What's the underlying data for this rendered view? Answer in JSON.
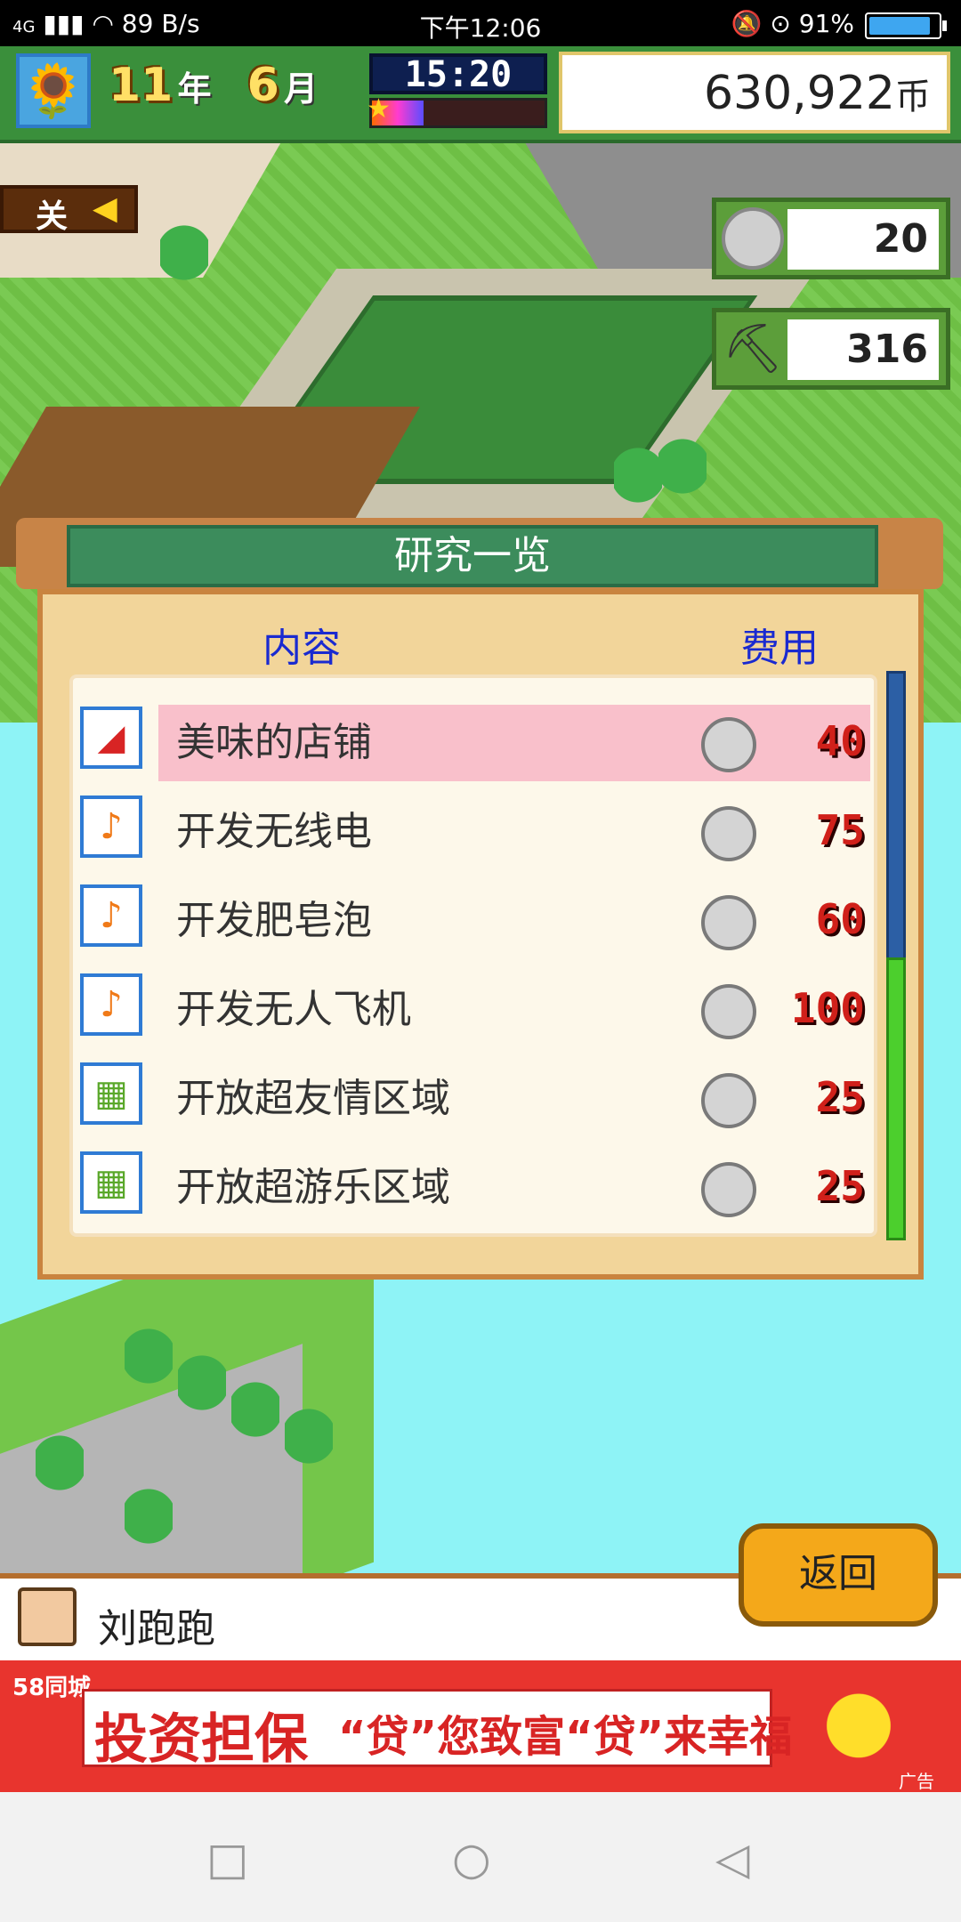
{
  "status_bar": {
    "network": "4G",
    "speed": "89 B/s",
    "time": "下午12:06",
    "battery": "91%"
  },
  "hud": {
    "flower_icon": "sunflower-icon",
    "year_num": "11",
    "year_unit": "年",
    "month_num": "6",
    "month_unit": "月",
    "clock": "15:20",
    "time_progress": 0.3,
    "money": "630,922",
    "money_unit": "币"
  },
  "side_tab": {
    "label": "关",
    "arrow": "◀"
  },
  "counters": {
    "coins": "20",
    "pickaxe": "316"
  },
  "research": {
    "title": "研究一览",
    "col_content": "内容",
    "col_cost": "费用",
    "items": [
      {
        "icon": "slide-icon",
        "name": "美味的店铺",
        "cost": "40",
        "selected": true
      },
      {
        "icon": "music-note-icon",
        "name": "开发无线电",
        "cost": "75",
        "selected": false
      },
      {
        "icon": "music-note-icon",
        "name": "开发肥皂泡",
        "cost": "60",
        "selected": false
      },
      {
        "icon": "music-note-icon",
        "name": "开发无人飞机",
        "cost": "100",
        "selected": false
      },
      {
        "icon": "flowerbed-icon",
        "name": "开放超友情区域",
        "cost": "25",
        "selected": false
      },
      {
        "icon": "flowerbed-icon",
        "name": "开放超游乐区域",
        "cost": "25",
        "selected": false
      }
    ]
  },
  "back_button": "返回",
  "message": {
    "name": "刘跑跑"
  },
  "ad": {
    "brand": "58同城",
    "main": "投资担保",
    "sub": "“贷”您致富“贷”来幸福",
    "tag": "广告"
  },
  "colors": {
    "hud_bg": "#3a8f3b",
    "panel_title_bg": "#3c8c5c",
    "selected_row": "#f9c0cb",
    "cost_red": "#d0201a",
    "header_blue": "#1a2ad0",
    "back_button": "#f4a81a"
  }
}
